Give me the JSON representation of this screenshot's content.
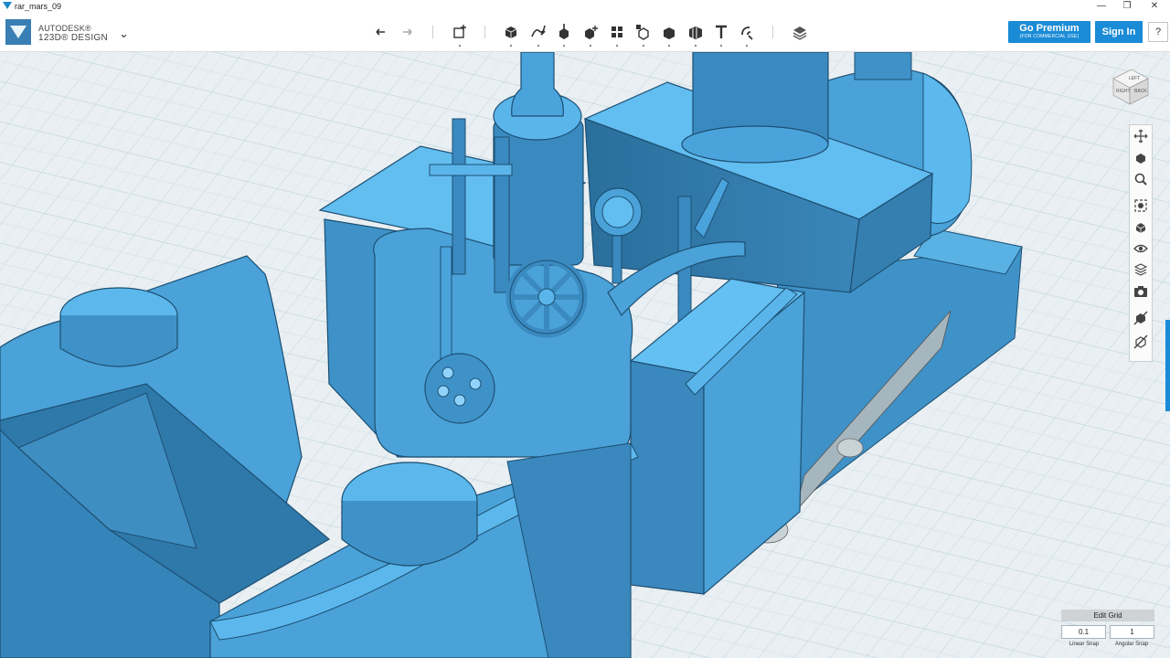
{
  "window": {
    "title": "rar_mars_09",
    "controls": [
      "—",
      "❐",
      "✕"
    ]
  },
  "brand": {
    "line1": "AUTODESK®",
    "line2": "123D® DESIGN",
    "menu_icon": "chevron-down-icon"
  },
  "toolbar": {
    "tools": [
      {
        "name": "undo-icon"
      },
      {
        "name": "redo-icon"
      },
      {
        "name": "transform-icon"
      },
      {
        "name": "primitives-icon"
      },
      {
        "name": "sketch-icon"
      },
      {
        "name": "construct-icon"
      },
      {
        "name": "modify-icon"
      },
      {
        "name": "pattern-icon"
      },
      {
        "name": "grouping-icon"
      },
      {
        "name": "combine-icon"
      },
      {
        "name": "measure-icon"
      },
      {
        "name": "text-icon"
      },
      {
        "name": "snap-icon"
      },
      {
        "name": "material-icon"
      }
    ]
  },
  "account": {
    "premium_label": "Go Premium",
    "premium_sub": "(FOR COMMERCIAL USE)",
    "signin_label": "Sign In",
    "help_label": "?"
  },
  "viewcube": {
    "faces": [
      "LEFT",
      "RIGHT",
      "BACK"
    ]
  },
  "nav_tools": [
    "pan-icon",
    "orbit-icon",
    "zoom-icon",
    "fit-icon",
    "views-icon",
    "visibility-icon",
    "materials-outline-icon",
    "camera-icon",
    "hide-icon",
    "hide-all-icon"
  ],
  "grid": {
    "edit_label": "Edit Grid",
    "linear_snap_value": "0.1",
    "angular_snap_value": "1",
    "linear_snap_label": "Linear Snap",
    "angular_snap_label": "Angular Snap"
  },
  "colors": {
    "model": "#4ba3dc",
    "accent": "#1a8bd6",
    "grid_bg": "#eaf0f3"
  }
}
